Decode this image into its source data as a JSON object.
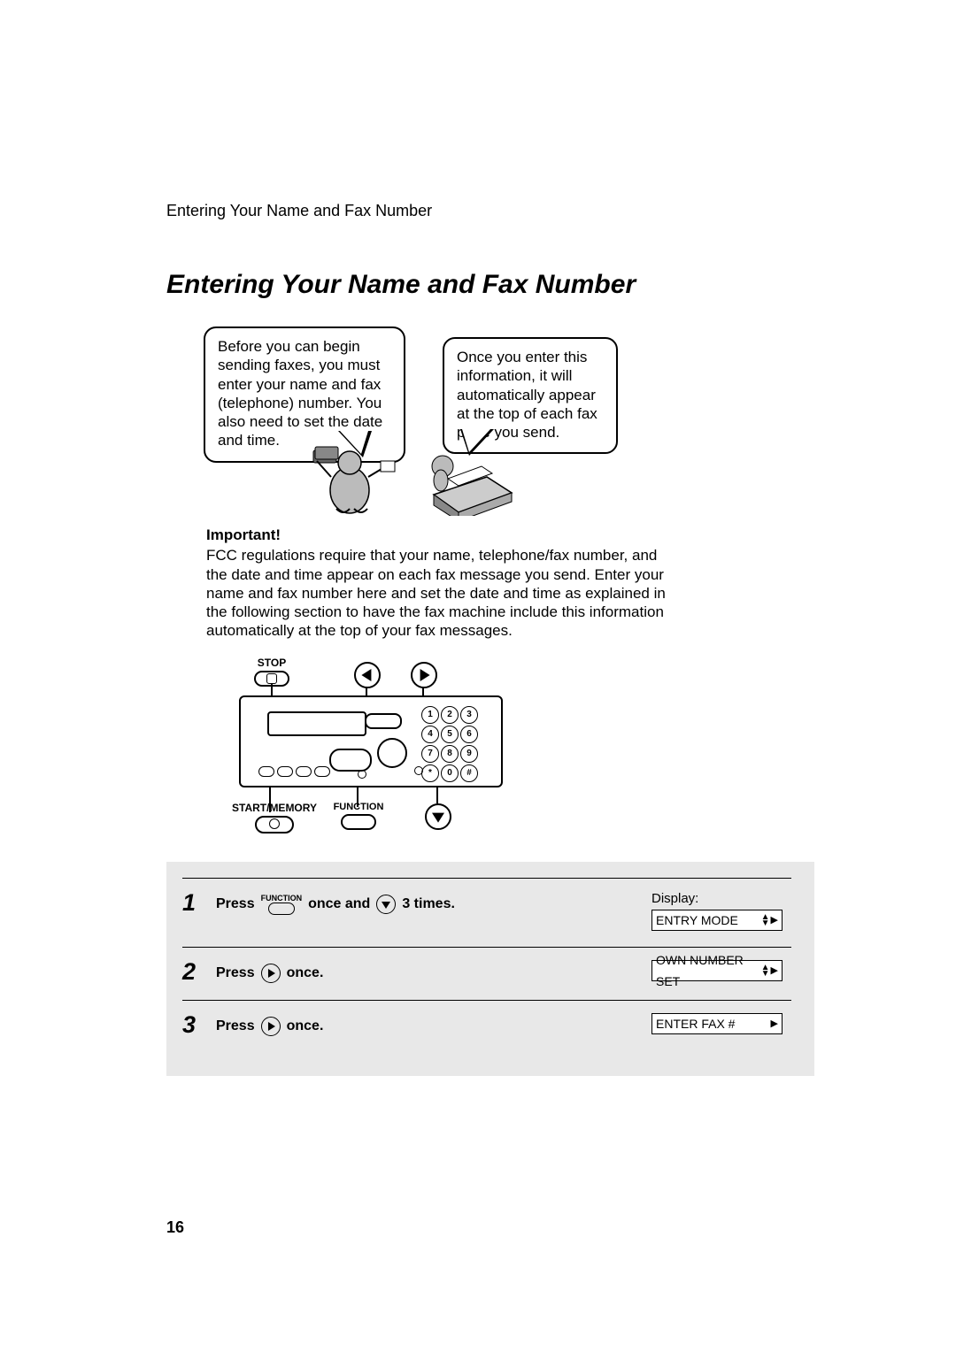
{
  "running_header": "Entering Your Name and Fax Number",
  "title": "Entering Your Name and Fax Number",
  "bubble_left": "Before you can begin sending faxes, you must enter your name and fax (telephone) number. You also need to set the date and time.",
  "bubble_right": "Once you enter this information, it will automatically appear at the top of each fax page you send.",
  "important_label": "Important!",
  "important_text": "FCC regulations require that your name, telephone/fax number, and the date and time appear on each fax message you send. Enter your name and fax number here and set the date and time as explained in the following section to have the fax machine include this information automatically at the top of your fax messages.",
  "diagram": {
    "stop": "STOP",
    "start_memory": "START/MEMORY",
    "function": "FUNCTION",
    "keys": [
      "1",
      "2",
      "3",
      "4",
      "5",
      "6",
      "7",
      "8",
      "9",
      "*",
      "0",
      "#"
    ]
  },
  "steps": [
    {
      "num": "1",
      "press": "Press",
      "function_label": "FUNCTION",
      "mid": " once and ",
      "tail": " 3 times.",
      "display_label": "Display:",
      "display_value": "ENTRY MODE",
      "show_ud": true,
      "use_down": true
    },
    {
      "num": "2",
      "press": "Press",
      "tail": " once.",
      "display_value": "OWN NUMBER SET",
      "show_ud": true,
      "use_right": true
    },
    {
      "num": "3",
      "press": "Press",
      "tail": " once.",
      "display_value": "ENTER FAX #",
      "show_ud": false,
      "use_right": true
    }
  ],
  "page_number": "16"
}
